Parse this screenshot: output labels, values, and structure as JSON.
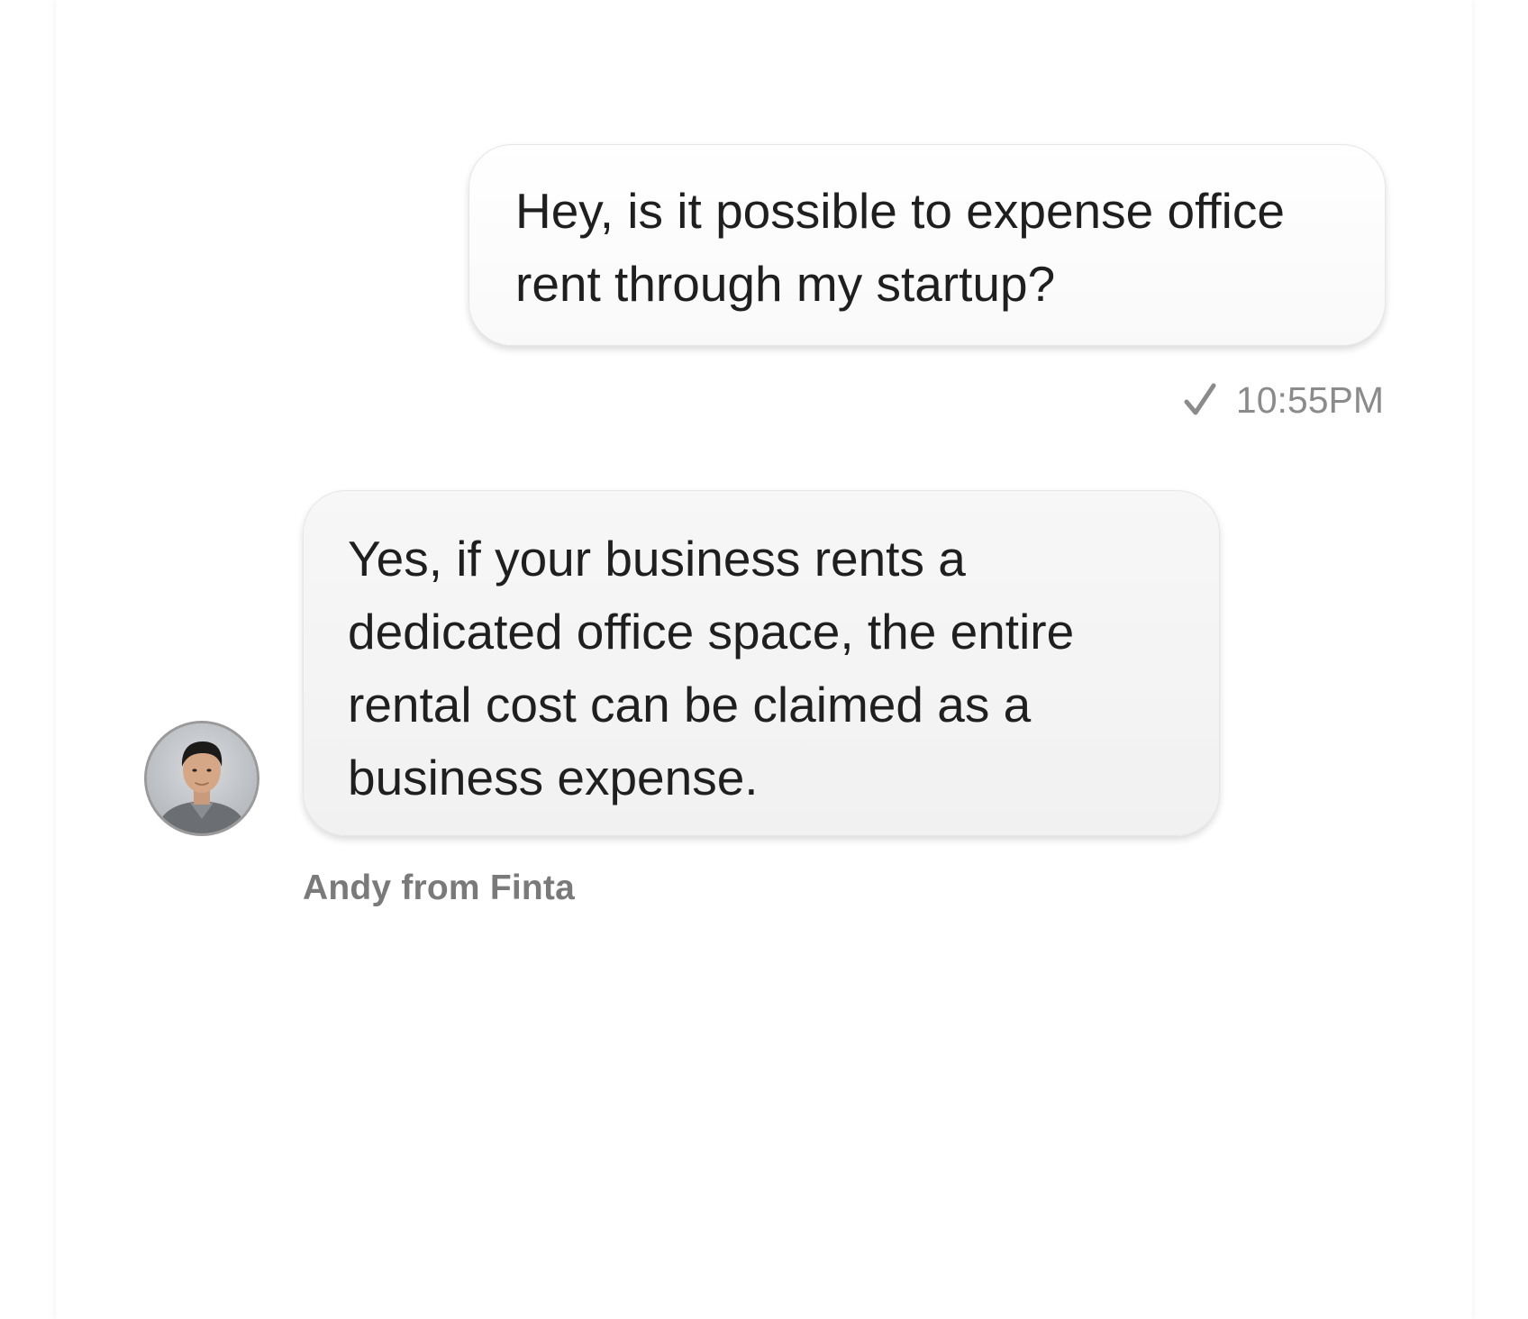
{
  "conversation": {
    "outgoing": {
      "lines": [
        "Hey, is it possible to expense office",
        "rent through my startup?"
      ],
      "status_icon": "check-icon",
      "time": "10:55PM"
    },
    "incoming": {
      "lines": [
        "Yes, if your business rents a",
        "dedicated office space, the entire",
        "rental cost can be claimed as a",
        "business expense."
      ],
      "sender": "Andy from Finta",
      "avatar": "avatar-photo"
    }
  },
  "colors": {
    "text": "#1f1f1f",
    "meta": "#8b8b8b",
    "sender": "#7a7a7a",
    "outgoing_bubble": "#fbfbfb",
    "incoming_bubble": "#f3f3f3"
  }
}
